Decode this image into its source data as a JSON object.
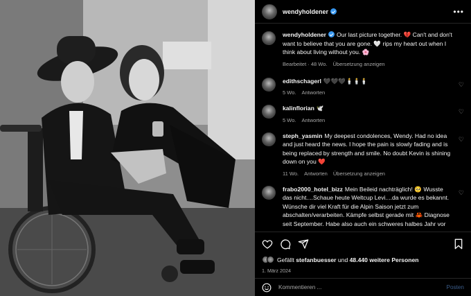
{
  "post": {
    "username": "wendyholdener",
    "caption": "Our last picture together. 💔 Can't and don't want to believe that you are gone. 🤍 rips my heart out when I think about living without you. 🌸",
    "edited_label": "Bearbeitet",
    "age": "48 Wo.",
    "translate_label": "Übersetzung anzeigen"
  },
  "comments": [
    {
      "username": "edithschagerl",
      "text": "🖤🖤🖤🕯️🕯️🕯️",
      "age": "5 Wo.",
      "reply": "Antworten",
      "translate": ""
    },
    {
      "username": "kalinflorian",
      "text": "🕊️",
      "age": "5 Wo.",
      "reply": "Antworten",
      "translate": ""
    },
    {
      "username": "steph_yasmin",
      "text": "My deepest condolences, Wendy. Had no idea and just heard the news. I hope the pain is slowly fading and is being replaced by strength and smile. No doubt Kevin is shining down on you ❤️",
      "age": "11 Wo.",
      "reply": "Antworten",
      "translate": "Übersetzung anzeigen"
    },
    {
      "username": "frabo2000_hotel_bizz",
      "text": "Mein Beileid nachträglich! 🥺 Wusste das nicht....Schaue heute Weltcup Levi....da wurde es bekannt. Wünsche dir viel Kraft für die Alpin Saison jetzt zum abschalten/verarbeiten. Kämpfe selbst gerade mit 🦀 Diagnose seit September. Habe also auch ein schweres halbes Jahr vor",
      "age": "",
      "reply": "",
      "translate": ""
    }
  ],
  "likes": {
    "prefix": "Gefällt",
    "user": "stefanbuesser",
    "middle": "und",
    "count": "48.440 weitere Personen"
  },
  "date": "1. März 2024",
  "composer": {
    "placeholder": "Kommentieren ...",
    "post_label": "Posten"
  },
  "icons": [
    "more-options-icon",
    "verified-badge-icon",
    "heart-icon",
    "comment-icon",
    "share-icon",
    "bookmark-icon",
    "emoji-icon"
  ],
  "colors": {
    "background": "#000000",
    "verified": "#3797f0",
    "muted": "#a8a8a8",
    "post_button": "#3c5e8c"
  }
}
